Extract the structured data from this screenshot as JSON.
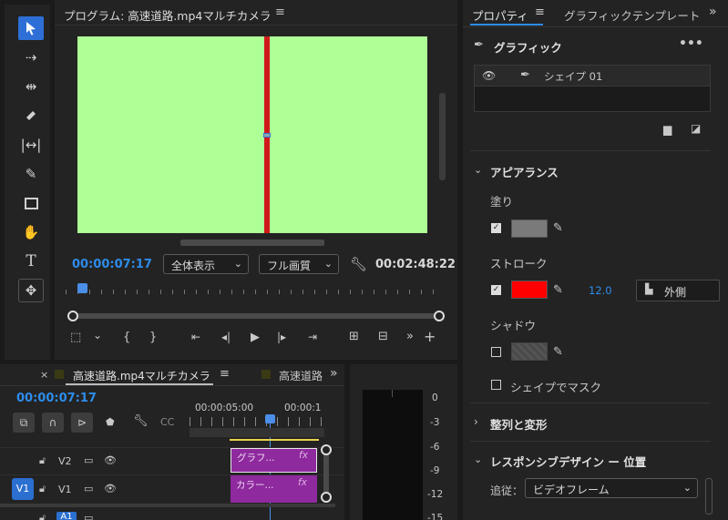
{
  "program": {
    "tab_title": "プログラム: 高速道路.mp4マルチカメラ",
    "timecode": "00:00:07:17",
    "fit_dropdown": "全体表示",
    "quality_dropdown": "フル画質",
    "duration": "00:02:48:22"
  },
  "properties": {
    "tab_properties": "プロパティ",
    "tab_graphic_template": "グラフィックテンプレート",
    "section_graphic": "グラフィック",
    "layer_name": "シェイプ 01",
    "section_appearance": "アピアランス",
    "fill_label": "塗り",
    "stroke_label": "ストローク",
    "stroke_width": "12.0",
    "stroke_position": "外側",
    "shadow_label": "シャドウ",
    "shape_mask_label": "シェイプでマスク",
    "section_align": "整列と変形",
    "section_responsive": "レスポンシブデザイン ー 位置",
    "follow_label": "追従：",
    "follow_value": "ビデオフレーム",
    "fill_color": "#7a7a7a",
    "stroke_color": "#ff0000"
  },
  "timeline": {
    "tab_active": "高速道路.mp4マルチカメラ",
    "tab_other": "高速道路",
    "timecode": "00:00:07:17",
    "ruler_label_1": "00:00:05:00",
    "ruler_label_2": "00:00:1",
    "track_v2": "V2",
    "track_v1": "V1",
    "track_v1_source": "V1",
    "track_a1_source": "A1",
    "clip_graphic": "グラフ...",
    "clip_color": "カラー...",
    "clip_fx": "fx"
  },
  "meter": {
    "scale": [
      "0",
      "-3",
      "-6",
      "-9",
      "-12",
      "-15"
    ]
  },
  "colors": {
    "accent": "#2d8ceb",
    "video_bg": "#adff96",
    "red_line": "#d01a1a",
    "clip_purple": "#8e2a9e"
  }
}
